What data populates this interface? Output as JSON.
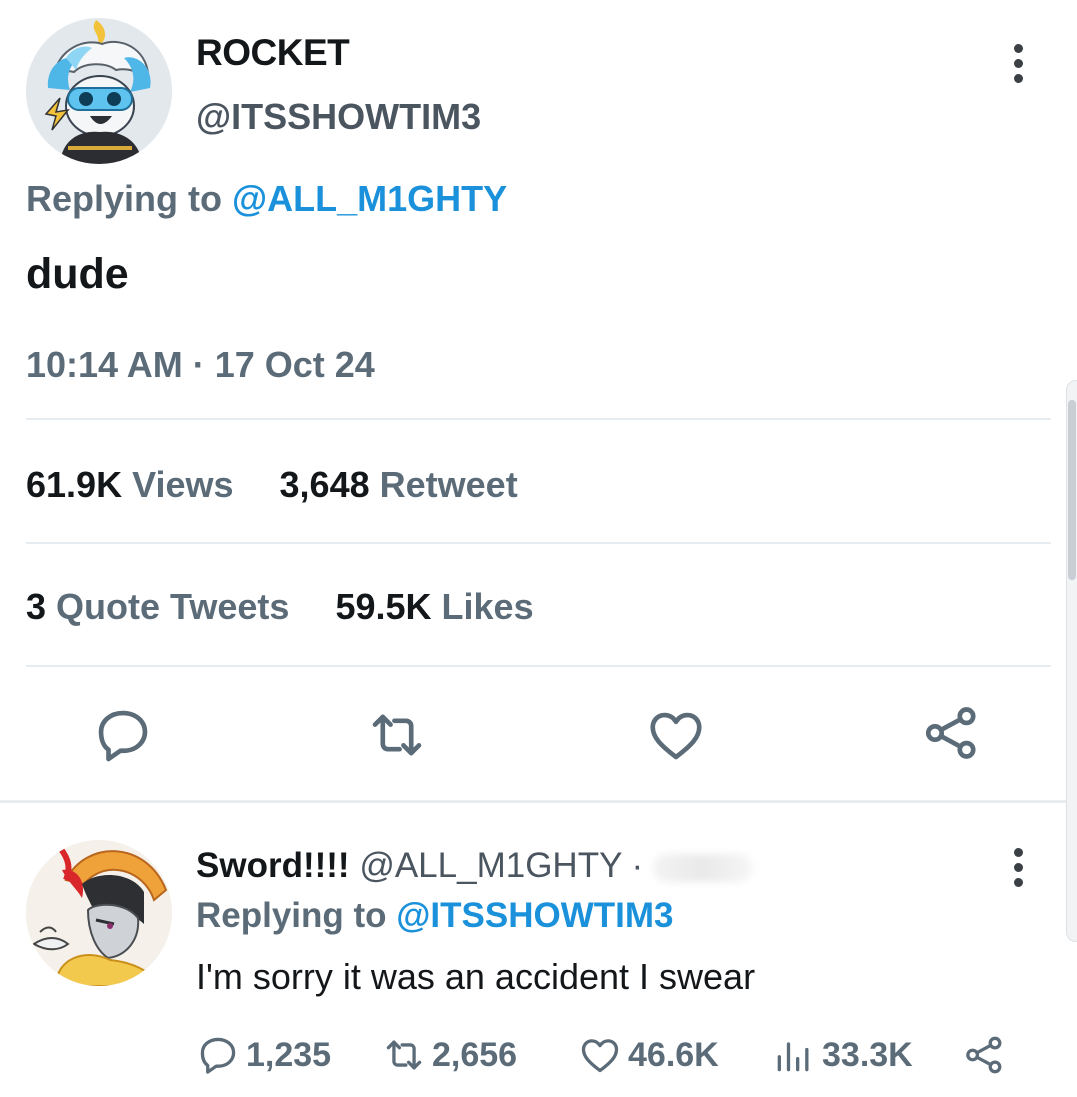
{
  "main_tweet": {
    "display_name": "ROCKET",
    "handle": "@ITSSHOWTIM3",
    "replying_prefix": "Replying to",
    "replying_handle": "@ALL_M1GHTY",
    "text": "dude",
    "timestamp": "10:14 AM · 17 Oct 24",
    "stats": {
      "views_count": "61.9K",
      "views_label": "Views",
      "retweets_count": "3,648",
      "retweets_label": "Retweet",
      "quotes_count": "3",
      "quotes_label": "Quote Tweets",
      "likes_count": "59.5K",
      "likes_label": "Likes"
    },
    "actions": [
      "reply-icon",
      "retweet-icon",
      "like-icon",
      "share-icon"
    ]
  },
  "reply_tweet": {
    "display_name": "Sword!!!!",
    "handle": "@ALL_M1GHTY ·",
    "replying_prefix": "Replying to",
    "replying_handle": "@ITSSHOWTIM3",
    "text": "I'm sorry it was an accident I swear",
    "actions": {
      "replies": "1,235",
      "retweets": "2,656",
      "likes": "46.6K",
      "views": "33.3K"
    }
  },
  "colors": {
    "link": "#1a91da",
    "text_primary": "#14171a",
    "text_secondary": "#5b6b78",
    "divider": "#e6ecf0"
  }
}
